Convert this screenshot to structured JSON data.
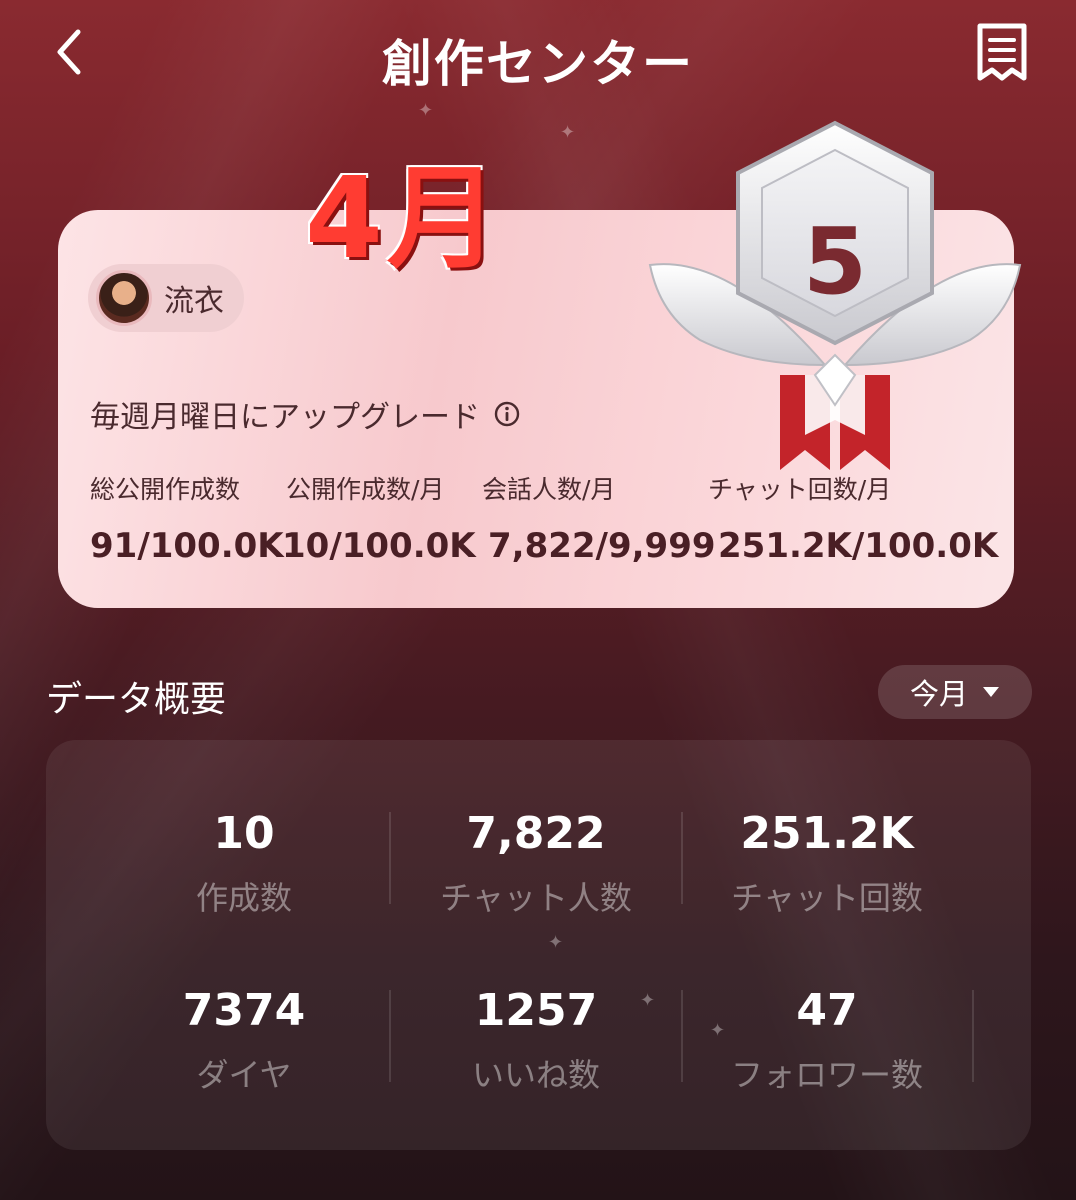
{
  "header": {
    "title": "創作センター"
  },
  "overlay_label": "4月",
  "creator_card": {
    "level": "5",
    "author_name": "流衣",
    "upgrade_note": "毎週月曜日にアップグレード",
    "stats": [
      {
        "label": "総公開作成数",
        "value": "91/100.0K"
      },
      {
        "label": "公開作成数/月",
        "value": "10/100.0K"
      },
      {
        "label": "会話人数/月",
        "value": "7,822/9,999"
      },
      {
        "label": "チャット回数/月",
        "value": "251.2K/100.0K"
      }
    ]
  },
  "data_overview": {
    "title": "データ概要",
    "period": "今月",
    "metrics": [
      {
        "value": "10",
        "label": "作成数"
      },
      {
        "value": "7,822",
        "label": "チャット人数"
      },
      {
        "value": "251.2K",
        "label": "チャット回数"
      },
      {
        "value": "7374",
        "label": "ダイヤ"
      },
      {
        "value": "1257",
        "label": "いいね数"
      },
      {
        "value": "47",
        "label": "フォロワー数"
      }
    ]
  },
  "colors": {
    "accent_red": "#ff3c32",
    "card_bg": "#f7c9cd",
    "text_dark": "#4a1f25"
  }
}
